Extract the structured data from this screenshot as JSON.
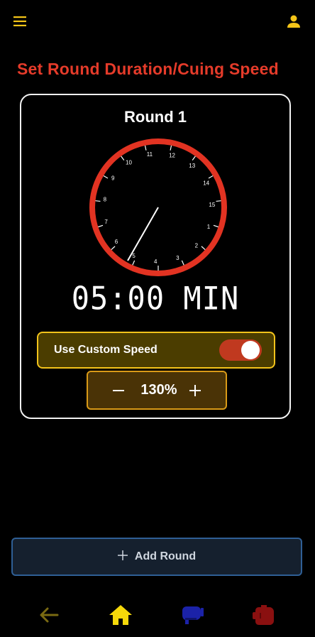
{
  "header": {
    "menu_icon": "hamburger-menu-icon",
    "user_icon": "user-icon"
  },
  "page_title": "Set Round Duration/Cuing Speed",
  "round": {
    "title": "Round 1",
    "clock_numbers": [
      "11",
      "12",
      "13",
      "14",
      "15",
      "1",
      "2",
      "3",
      "4",
      "5",
      "6",
      "7",
      "8",
      "9",
      "10"
    ],
    "duration": "05:00 MIN"
  },
  "custom_speed": {
    "label": "Use Custom Speed",
    "enabled": true
  },
  "speed": {
    "value": "130%",
    "minus_icon": "minus-icon",
    "plus_icon": "plus-icon"
  },
  "add_round": {
    "label": "Add Round",
    "icon": "plus-icon"
  },
  "bottom_nav": [
    {
      "name": "back",
      "icon": "arrow-left-icon",
      "color": "#7a6a12"
    },
    {
      "name": "home",
      "icon": "home-icon",
      "color": "#f5d80a"
    },
    {
      "name": "blue-glove",
      "icon": "boxing-glove-icon",
      "color": "#1b22a8"
    },
    {
      "name": "red-glove",
      "icon": "boxing-glove-icon",
      "color": "#8a1010"
    }
  ],
  "colors": {
    "accent_red": "#e53b2a",
    "accent_yellow": "#f2c31b",
    "clock_ring": "#e23322"
  }
}
